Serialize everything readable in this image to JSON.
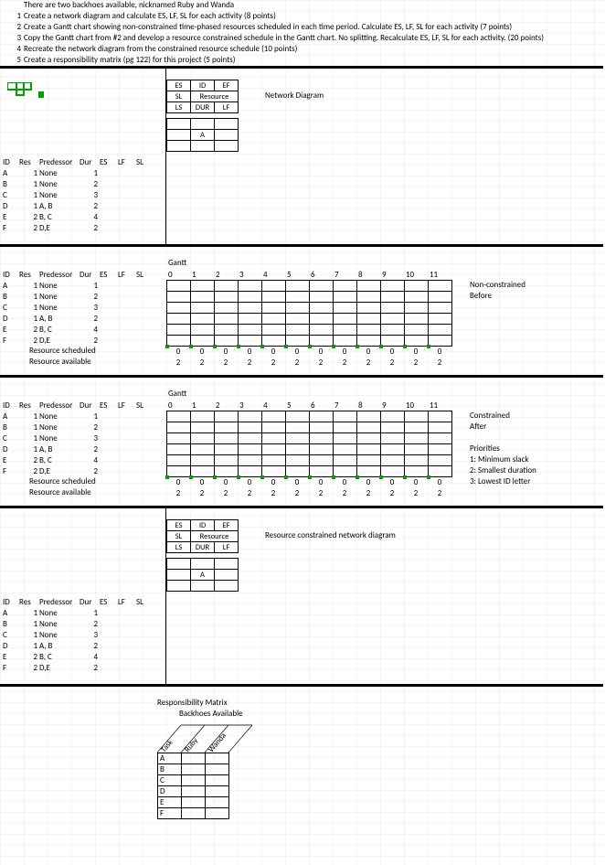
{
  "intro": {
    "title": "There are two backhoes available, nicknamed Ruby and Wanda",
    "items": [
      {
        "num": "1",
        "text": "Create a network diagram and calculate ES, LF, SL for each activity (8 points)"
      },
      {
        "num": "2",
        "text": "Create a Gantt chart showing non-constrained time-phased resources scheduled in each time period. Calculate ES, LF, SL for each activity (7 points)"
      },
      {
        "num": "3",
        "text": "Copy the Gantt chart from #2 and develop a resource constrained schedule in the Gantt chart. No splitting. Recalculate ES, LF, SL for each activity. (20 points)"
      },
      {
        "num": "4",
        "text": "Recreate the network diagram from the constrained resource schedule (10 points)"
      },
      {
        "num": "5",
        "text": "Create a responsibility matrix (pg 122) for this project (5 points)"
      }
    ]
  },
  "headerBox": {
    "r1": [
      "ES",
      "ID",
      "EF"
    ],
    "r2": [
      "SL",
      "Resource",
      ""
    ],
    "r3": [
      "LS",
      "DUR",
      "LF"
    ]
  },
  "section1": {
    "diagramLabel": "Network Diagram",
    "activityA": "A"
  },
  "activityCols": [
    "ID",
    "Res",
    "Predessor",
    "Dur",
    "ES",
    "LF",
    "SL"
  ],
  "activities": [
    {
      "id": "A",
      "res": "1",
      "pred": "None",
      "dur": "1"
    },
    {
      "id": "B",
      "res": "1",
      "pred": "None",
      "dur": "2"
    },
    {
      "id": "C",
      "res": "1",
      "pred": "None",
      "dur": "3"
    },
    {
      "id": "D",
      "res": "1",
      "pred": "A, B",
      "dur": "2"
    },
    {
      "id": "E",
      "res": "2",
      "pred": "B, C",
      "dur": "4"
    },
    {
      "id": "F",
      "res": "2",
      "pred": "D,E",
      "dur": "2"
    }
  ],
  "ganttLabel": "Gantt",
  "ganttCols": [
    "0",
    "1",
    "2",
    "3",
    "4",
    "5",
    "6",
    "7",
    "8",
    "9",
    "10",
    "11"
  ],
  "section2": {
    "label1": "Non-constrained",
    "label2": "Before"
  },
  "resourceScheduled": "Resource scheduled",
  "resourceAvailable": "Resource available",
  "scheduledRow": [
    "0",
    "0",
    "0",
    "0",
    "0",
    "0",
    "0",
    "0",
    "0",
    "0",
    "0",
    "0"
  ],
  "availableRow": [
    "2",
    "2",
    "2",
    "2",
    "2",
    "2",
    "2",
    "2",
    "2",
    "2",
    "2",
    "2"
  ],
  "section3": {
    "label1": "Constrained",
    "label2": "After",
    "prioritiesTitle": "Priorities",
    "priority1": "1: Minimum slack",
    "priority2": "2: Smallest duration",
    "priority3": "3: Lowest ID letter"
  },
  "section4": {
    "diagramLabel": "Resource constrained network diagram"
  },
  "section5": {
    "title": "Responsibility Matrix",
    "subtitle": "Backhoes Available",
    "cols": [
      "Task",
      "Ruby",
      "Wanda"
    ],
    "rows": [
      "A",
      "B",
      "C",
      "D",
      "E",
      "F"
    ]
  }
}
